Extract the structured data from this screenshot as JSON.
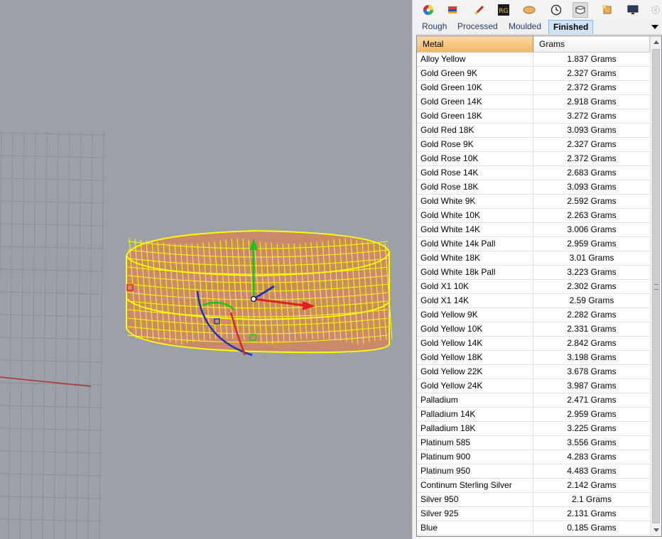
{
  "toolbar": {
    "icons": [
      "color-wheel-icon",
      "layers-icon",
      "brush-icon",
      "rg-plugin-icon",
      "metal-icon",
      "clock-icon",
      "ring-icon",
      "gem-icon",
      "display-icon",
      "settings-icon"
    ],
    "rg_label": "RG"
  },
  "tabs": [
    {
      "label": "Rough"
    },
    {
      "label": "Processed"
    },
    {
      "label": "Moulded"
    },
    {
      "label": "Finished"
    }
  ],
  "active_tab": "Finished",
  "table": {
    "columns": [
      "Metal",
      "Grams"
    ],
    "rows": [
      {
        "metal": "Alloy Yellow",
        "grams": "1.837 Grams"
      },
      {
        "metal": "Gold Green 9K",
        "grams": "2.327 Grams"
      },
      {
        "metal": "Gold Green 10K",
        "grams": "2.372 Grams"
      },
      {
        "metal": "Gold Green 14K",
        "grams": "2.918 Grams"
      },
      {
        "metal": "Gold Green 18K",
        "grams": "3.272 Grams"
      },
      {
        "metal": "Gold Red 18K",
        "grams": "3.093 Grams"
      },
      {
        "metal": "Gold Rose 9K",
        "grams": "2.327 Grams"
      },
      {
        "metal": "Gold Rose 10K",
        "grams": "2.372 Grams"
      },
      {
        "metal": "Gold Rose 14K",
        "grams": "2.683 Grams"
      },
      {
        "metal": "Gold Rose 18K",
        "grams": "3.093 Grams"
      },
      {
        "metal": "Gold White 9K",
        "grams": "2.592 Grams"
      },
      {
        "metal": "Gold White 10K",
        "grams": "2.263 Grams"
      },
      {
        "metal": "Gold White 14K",
        "grams": "3.006 Grams"
      },
      {
        "metal": "Gold White 14k Pall",
        "grams": "2.959 Grams"
      },
      {
        "metal": "Gold White 18K",
        "grams": "3.01 Grams"
      },
      {
        "metal": "Gold White 18k Pall",
        "grams": "3.223 Grams"
      },
      {
        "metal": "Gold X1 10K",
        "grams": "2.302 Grams"
      },
      {
        "metal": "Gold X1 14K",
        "grams": "2.59 Grams"
      },
      {
        "metal": "Gold Yellow 9K",
        "grams": "2.282 Grams"
      },
      {
        "metal": "Gold Yellow 10K",
        "grams": "2.331 Grams"
      },
      {
        "metal": "Gold Yellow 14K",
        "grams": "2.842 Grams"
      },
      {
        "metal": "Gold Yellow 18K",
        "grams": "3.198 Grams"
      },
      {
        "metal": "Gold Yellow 22K",
        "grams": "3.678 Grams"
      },
      {
        "metal": "Gold Yellow 24K",
        "grams": "3.987 Grams"
      },
      {
        "metal": "Palladium",
        "grams": "2.471 Grams"
      },
      {
        "metal": "Palladium 14K",
        "grams": "2.959 Grams"
      },
      {
        "metal": "Palladium 18K",
        "grams": "3.225 Grams"
      },
      {
        "metal": "Platinum 585",
        "grams": "3.556 Grams"
      },
      {
        "metal": "Platinum 900",
        "grams": "4.283 Grams"
      },
      {
        "metal": "Platinum 950",
        "grams": "4.483 Grams"
      },
      {
        "metal": "Continum Sterling Silver",
        "grams": "2.142 Grams"
      },
      {
        "metal": "Silver 950",
        "grams": "2.1 Grams"
      },
      {
        "metal": "Silver 925",
        "grams": "2.131 Grams"
      },
      {
        "metal": "Blue",
        "grams": "0.185 Grams"
      }
    ]
  },
  "colors": {
    "viewport_bg": "#9ca0a7",
    "wireframe": "#ffff00",
    "header_sorted": "#f4b765",
    "active_tab": "#cfe4fa",
    "gumball_x": "#e02020",
    "gumball_y": "#20c020",
    "gumball_z": "#2030c0"
  }
}
